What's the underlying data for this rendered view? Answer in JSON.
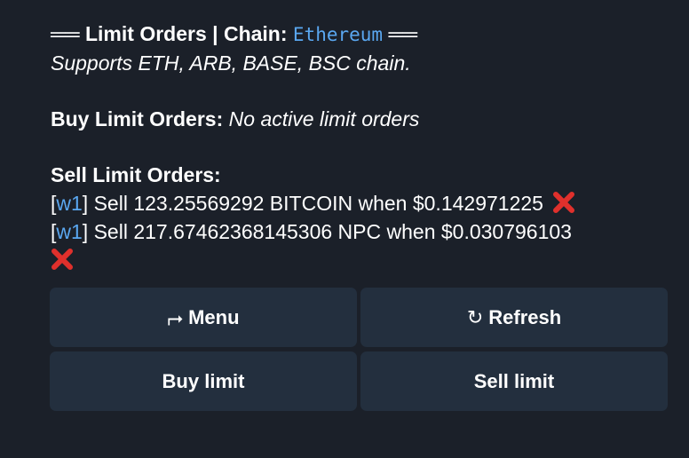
{
  "message": {
    "header": {
      "prefix": "══",
      "title": "Limit Orders | Chain: ",
      "chain": "Ethereum",
      "suffix": "══"
    },
    "subtitle": "Supports ETH, ARB, BASE, BSC chain.",
    "buy": {
      "label": "Buy Limit Orders:",
      "status": "No active limit orders"
    },
    "sell": {
      "label": "Sell Limit Orders:",
      "orders": [
        {
          "bracket_open": "[",
          "wallet": "w1",
          "bracket_close": "]",
          "text": " Sell 123.25569292 BITCOIN when $0.142971225",
          "cancel_icon": "cross-mark-icon",
          "cancel_color": "#e0302c"
        },
        {
          "bracket_open": "[",
          "wallet": "w1",
          "bracket_close": "]",
          "text": " Sell 217.67462368145306 NPC when $0.030796103",
          "cancel_icon": "cross-mark-icon",
          "cancel_color": "#e0302c"
        }
      ]
    }
  },
  "keyboard": {
    "menu": {
      "icon": "⮣",
      "label": "Menu"
    },
    "refresh": {
      "icon": "↻",
      "label": "Refresh"
    },
    "buy_limit": {
      "label": "Buy limit"
    },
    "sell_limit": {
      "label": "Sell limit"
    }
  },
  "colors": {
    "background": "#1b2029",
    "button": "#232f3e",
    "link": "#5aa7f0",
    "cross": "#e0302c"
  }
}
